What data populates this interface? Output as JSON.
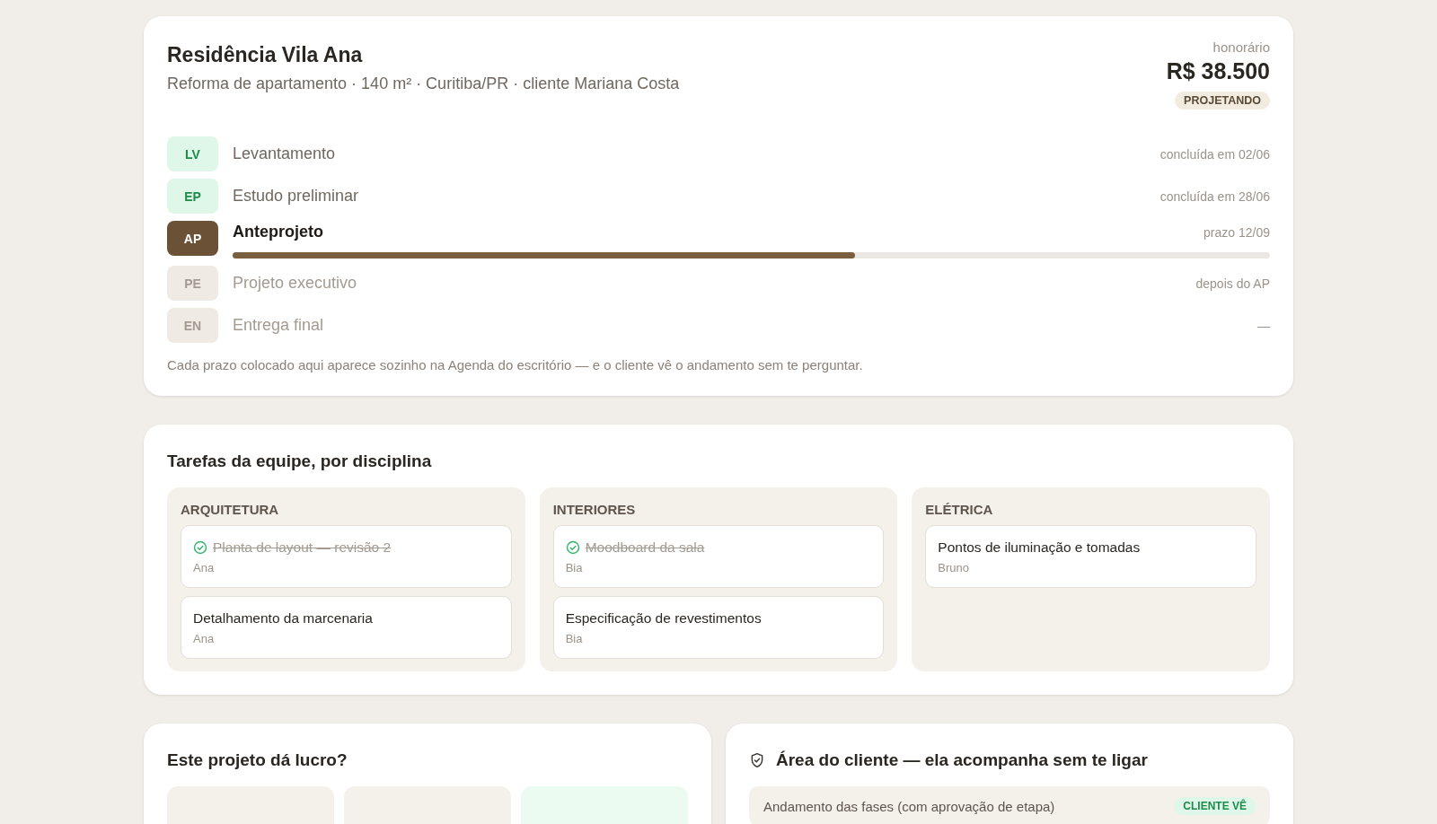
{
  "project": {
    "title": "Residência Vila Ana",
    "subtitle": "Reforma de apartamento · 140 m² · Curitiba/PR · cliente Mariana Costa",
    "fee_label": "honorário",
    "fee": "R$ 38.500",
    "status": "PROJETANDO"
  },
  "phases": [
    {
      "code": "LV",
      "name": "Levantamento",
      "note": "concluída em 02/06",
      "kind": "done"
    },
    {
      "code": "EP",
      "name": "Estudo preliminar",
      "note": "concluída em 28/06",
      "kind": "done"
    },
    {
      "code": "AP",
      "name": "Anteprojeto",
      "note": "prazo 12/09",
      "kind": "current",
      "level": 0.6
    },
    {
      "code": "PE",
      "name": "Projeto executivo",
      "note": "depois do AP",
      "kind": "pending"
    },
    {
      "code": "EN",
      "name": "Entrega final",
      "note": "—",
      "kind": "pending"
    }
  ],
  "phases_footnote": "Cada prazo colocado aqui aparece sozinho na Agenda do escritório — e o cliente vê o andamento sem te perguntar.",
  "tasks": {
    "title": "Tarefas da equipe, por disciplina",
    "columns": [
      {
        "name": "ARQUITETURA",
        "items": [
          {
            "title": "Planta de layout — revisão 2",
            "assignee": "Ana",
            "done": true
          },
          {
            "title": "Detalhamento da marcenaria",
            "assignee": "Ana",
            "done": false
          }
        ]
      },
      {
        "name": "INTERIORES",
        "items": [
          {
            "title": "Moodboard da sala",
            "assignee": "Bia",
            "done": true
          },
          {
            "title": "Especificação de revestimentos",
            "assignee": "Bia",
            "done": false
          }
        ]
      },
      {
        "name": "ELÉTRICA",
        "items": [
          {
            "title": "Pontos de iluminação e tomadas",
            "assignee": "Bruno",
            "done": false
          }
        ]
      }
    ]
  },
  "profit": {
    "title": "Este projeto dá lucro?",
    "tiles": [
      {
        "color": "#f4f1ea"
      },
      {
        "color": "#f4f1ea"
      },
      {
        "color": "#ecfbf2"
      }
    ]
  },
  "client_area": {
    "title": "Área do cliente — ela acompanha sem te ligar",
    "rows": [
      {
        "label": "Andamento das fases (com aprovação de etapa)",
        "badge": "CLIENTE VÊ"
      }
    ]
  }
}
